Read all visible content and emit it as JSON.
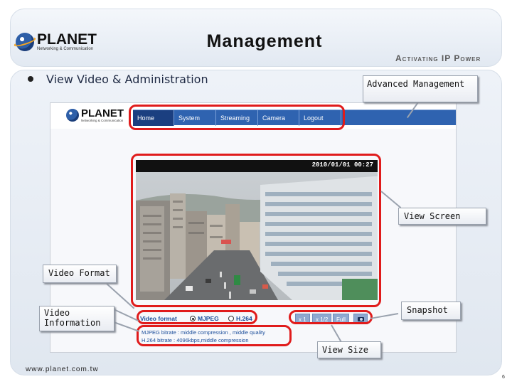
{
  "slide": {
    "title": "Management",
    "slogan": "Activating IP Power",
    "bullet": "View Video & Administration",
    "footer_url": "www.planet.com.tw",
    "page_number": "6"
  },
  "logo": {
    "brand": "PLANET",
    "tagline": "Networking & Communication"
  },
  "webui": {
    "logo": {
      "brand": "PLANET",
      "tagline": "Networking & Communication"
    },
    "nav": [
      "Home",
      "System",
      "Streaming",
      "Camera",
      "Logout"
    ],
    "active_nav": "Home",
    "timestamp": "2010/01/01 00:27",
    "video_format_label": "Video format",
    "format_options": [
      "MJPEG",
      "H.264"
    ],
    "selected_format": "MJPEG",
    "size_buttons": [
      "x 1",
      "x 1/2",
      "Full"
    ],
    "info_lines": [
      "MJPEG bitrate : middle compression , middle quality",
      "H.264 bitrate : 4096kbps,middle compression"
    ]
  },
  "callouts": {
    "advanced_management": "Advanced Management",
    "view_screen": "View Screen",
    "video_format": "Video Format",
    "snapshot": "Snapshot",
    "video_information": "Video Information",
    "view_size": "View Size"
  },
  "colors": {
    "highlight": "#e01b1b",
    "nav_bar": "#2f63b0",
    "nav_active": "#1b3f80",
    "ui_text": "#1a4d9a"
  }
}
